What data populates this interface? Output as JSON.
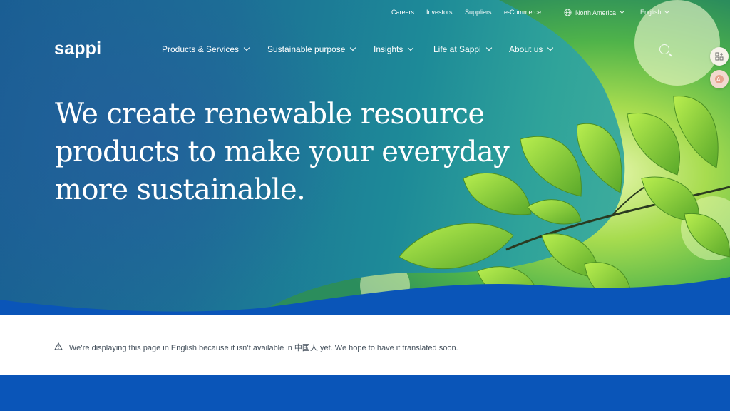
{
  "utility_nav": {
    "links": [
      "Careers",
      "Investors",
      "Suppliers",
      "e-Commerce"
    ],
    "region": "North America",
    "language": "English"
  },
  "header": {
    "logo": "sappi",
    "nav": [
      "Products & Services",
      "Sustainable purpose",
      "Insights",
      "Life at Sappi",
      "About us"
    ]
  },
  "hero": {
    "headline_lines": [
      "We create renewable resource",
      "products to make your everyday",
      "more sustainable."
    ]
  },
  "notice": {
    "text": "We’re displaying this page in English because it isn’t available in 中国人 yet. We hope to have it translated soon."
  },
  "icons": {
    "search": "search-icon",
    "globe": "globe-icon",
    "warning": "warning-icon",
    "translate": "translate-icon",
    "apps": "apps-icon"
  },
  "colors": {
    "hero_blue": "#1a5e93",
    "hero_teal": "#1d8a98",
    "band_blue": "#0a55b8",
    "leaf_green": "#7fd13a"
  }
}
